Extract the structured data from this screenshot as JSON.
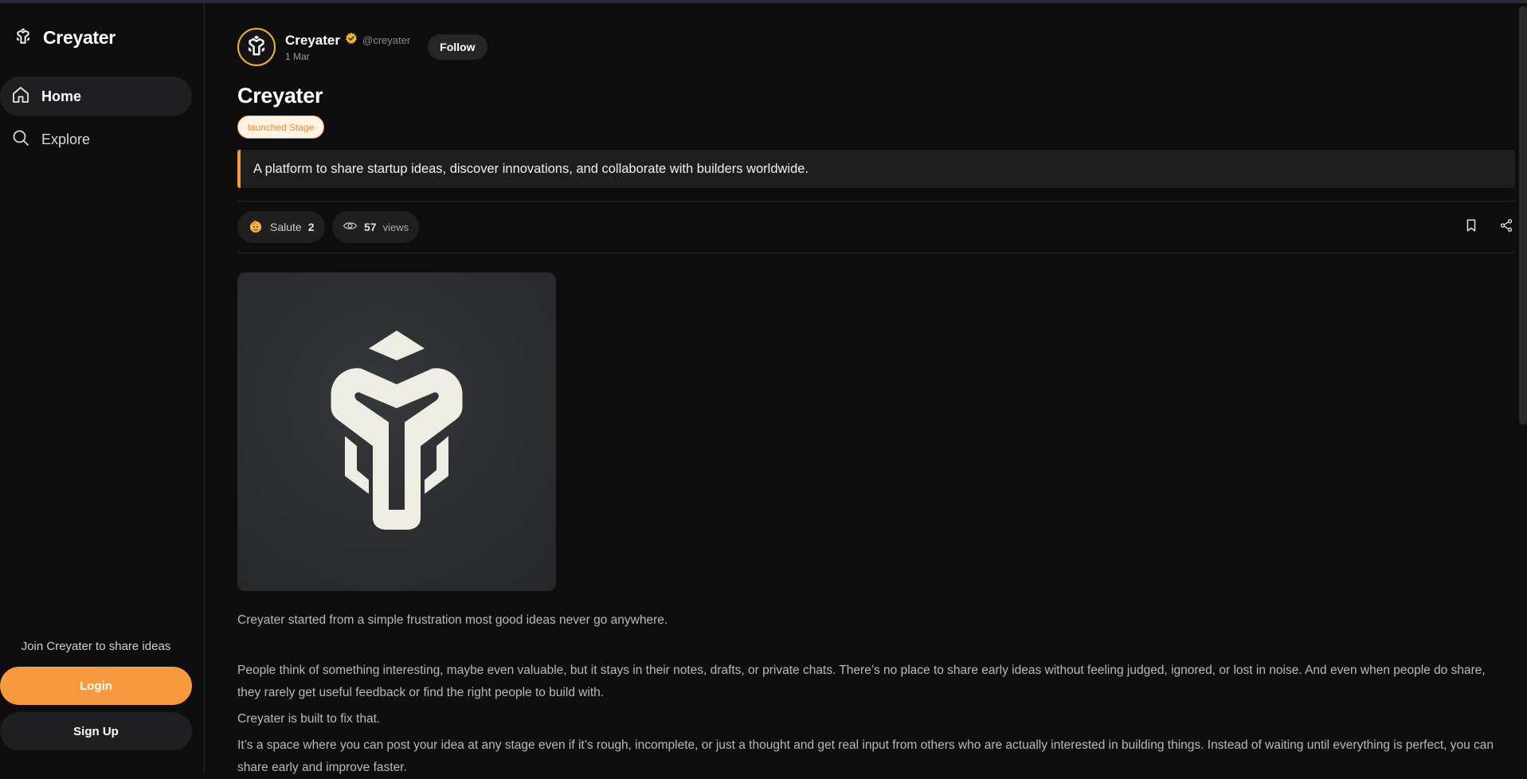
{
  "brand": {
    "name": "Creyater"
  },
  "nav": {
    "items": [
      {
        "label": "Home",
        "active": true,
        "icon": "home-icon"
      },
      {
        "label": "Explore",
        "active": false,
        "icon": "search-icon"
      }
    ]
  },
  "sidebar_footer": {
    "join_text": "Join Creyater to share ideas",
    "login_label": "Login",
    "signup_label": "Sign Up"
  },
  "post": {
    "author_name": "Creyater",
    "handle": "@creyater",
    "date": "1 Mar",
    "follow_label": "Follow",
    "title": "Creyater",
    "stage": "launched Stage",
    "tagline": "A platform to share startup ideas, discover innovations, and collaborate with builders worldwide.",
    "salute_label": "Salute",
    "salute_count": "2",
    "views_count": "57",
    "views_label": "views",
    "paragraphs": [
      "Creyater started from a simple frustration most good ideas never go anywhere.",
      "People think of something interesting, maybe even valuable, but it stays in their notes, drafts, or private chats. There’s no place to share early ideas without feeling judged, ignored, or lost in noise. And even when people do share, they rarely get useful feedback or find the right people to build with.",
      "Creyater is built to fix that.",
      "It’s a space where you can post your idea at any stage even if it’s rough, incomplete, or just a thought and get real input from others who are actually interested in building things. Instead of waiting until everything is perfect, you can share early and improve faster."
    ]
  },
  "colors": {
    "accent": "#f79a3e",
    "verified": "#f0b429",
    "background": "#0e0e0f"
  }
}
